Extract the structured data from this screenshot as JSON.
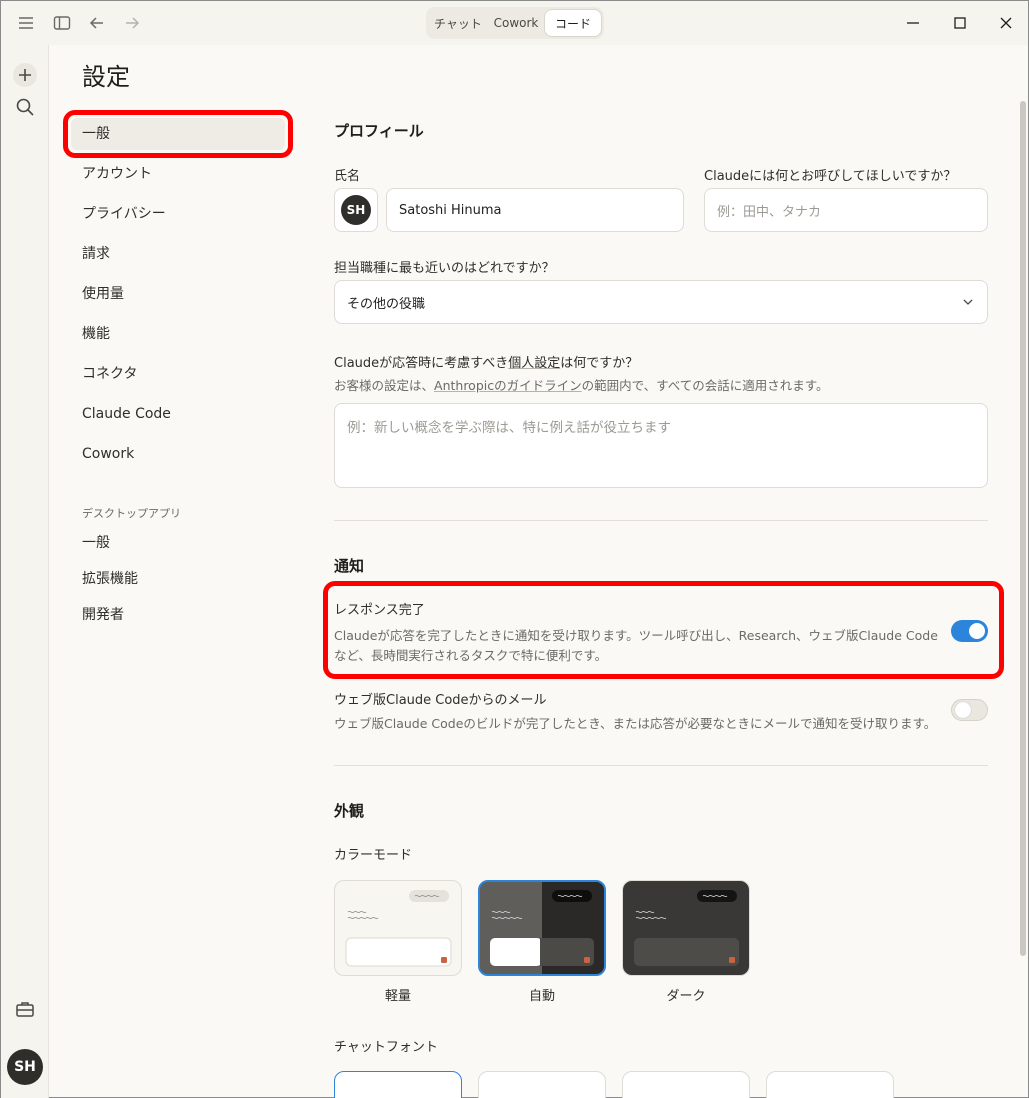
{
  "window": {
    "modes": [
      "チャット",
      "Cowork",
      "コード"
    ],
    "active_mode": "コード"
  },
  "rail": {
    "avatar": "SH"
  },
  "page": {
    "title": "設定"
  },
  "settings_nav": {
    "items": [
      "一般",
      "アカウント",
      "プライバシー",
      "請求",
      "使用量",
      "機能",
      "コネクタ",
      "Claude Code",
      "Cowork"
    ],
    "active": "一般",
    "section_label": "デスクトップアプリ",
    "app_items": [
      "一般",
      "拡張機能",
      "開発者"
    ]
  },
  "profile": {
    "heading": "プロフィール",
    "name_label": "氏名",
    "avatar": "SH",
    "name_value": "Satoshi Hinuma",
    "call_label": "Claudeには何とお呼びしてほしいですか？",
    "call_placeholder": "例：田中、タナカ",
    "role_label": "担当職種に最も近いのはどれですか？",
    "role_value": "その他の役職",
    "pref_label_a": "Claudeが応答時に考慮すべき",
    "pref_label_link": "個人設定",
    "pref_label_b": "は何ですか？",
    "pref_sub_a": "お客様の設定は、",
    "pref_sub_link": "Anthropicのガイドライン",
    "pref_sub_b": "の範囲内で、すべての会話に適用されます。",
    "pref_placeholder": "例：新しい概念を学ぶ際は、特に例え話が役立ちます"
  },
  "notifications": {
    "heading": "通知",
    "response_title": "レスポンス完了",
    "response_desc_1": "Claudeが応答を完了したときに通知を受け取ります。ツール呼び出し、Research、ウェブ版Claude Code",
    "response_desc_2": "など、長時間実行されるタスクで特に便利です。",
    "response_enabled": true,
    "email_title": "ウェブ版Claude Codeからのメール",
    "email_desc": "ウェブ版Claude Codeのビルドが完了したとき、または応答が必要なときにメールで通知を受け取ります。",
    "email_enabled": false
  },
  "appearance": {
    "heading": "外観",
    "color_mode_label": "カラーモード",
    "themes": [
      "軽量",
      "自動",
      "ダーク"
    ],
    "selected_theme": "自動",
    "chat_font_label": "チャットフォント"
  },
  "colors": {
    "accent": "#2c84db",
    "highlight": "#ff0000",
    "send_dot": "#c96442"
  }
}
